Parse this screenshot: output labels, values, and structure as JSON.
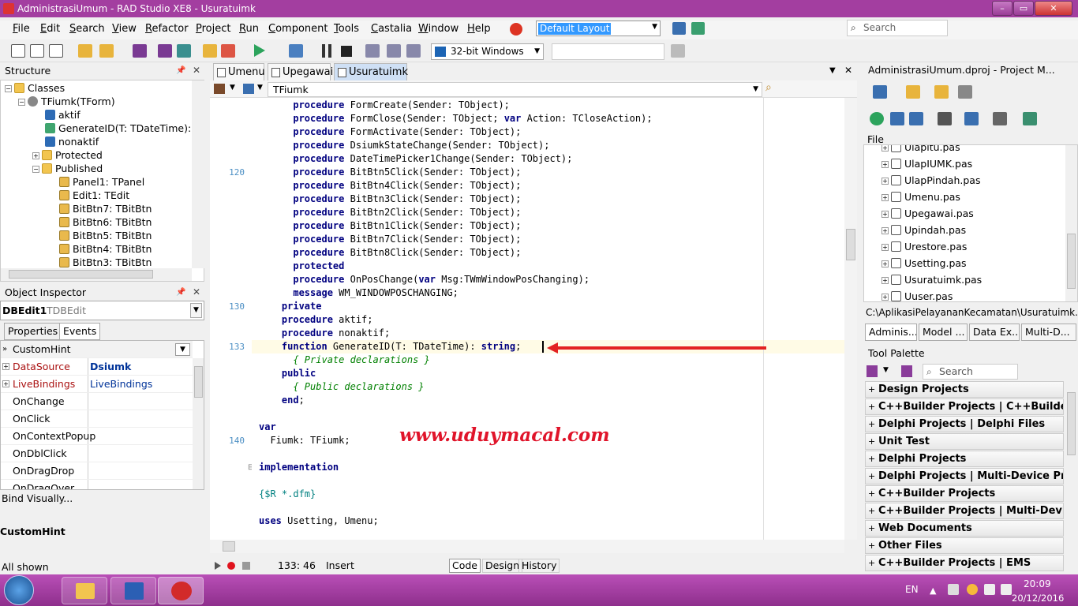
{
  "window": {
    "title": "AdministrasiUmum - RAD Studio XE8 - Usuratuimk"
  },
  "menu": [
    "File",
    "Edit",
    "Search",
    "View",
    "Refactor",
    "Project",
    "Run",
    "Component",
    "Tools",
    "Castalia",
    "Window",
    "Help"
  ],
  "layout_combo": "Default Layout",
  "search_top": "Search",
  "platform_combo": "32-bit Windows",
  "structure": {
    "title": "Structure",
    "rows": [
      "Classes",
      "TFiumk(TForm)",
      "aktif",
      "GenerateID(T: TDateTime): str",
      "nonaktif",
      "Protected",
      "Published",
      "Panel1: TPanel",
      "Edit1: TEdit",
      "BitBtn7: TBitBtn",
      "BitBtn6: TBitBtn",
      "BitBtn5: TBitBtn",
      "BitBtn4: TBitBtn",
      "BitBtn3: TBitBtn"
    ]
  },
  "object_inspector": {
    "title": "Object Inspector",
    "component": "DBEdit1",
    "component_type": "TDBEdit",
    "tab_properties": "Properties",
    "tab_events": "Events",
    "rows": [
      {
        "name": "CustomHint",
        "value": ""
      },
      {
        "name": "DataSource",
        "value": "Dsiumk"
      },
      {
        "name": "LiveBindings",
        "value": "LiveBindings"
      },
      {
        "name": "OnChange",
        "value": ""
      },
      {
        "name": "OnClick",
        "value": ""
      },
      {
        "name": "OnContextPopup",
        "value": ""
      },
      {
        "name": "OnDblClick",
        "value": ""
      },
      {
        "name": "OnDragDrop",
        "value": ""
      },
      {
        "name": "OnDragOver",
        "value": ""
      }
    ],
    "bind_visually": "Bind Visually...",
    "selected_prop": "CustomHint",
    "status": "All shown"
  },
  "editor": {
    "tabs": [
      "Umenu",
      "Upegawai",
      "Usuratuimk"
    ],
    "class_combo": "TFiumk",
    "line_numbers": [
      {
        "n": "120",
        "row": 5
      },
      {
        "n": "130",
        "row": 15
      },
      {
        "n": "133",
        "row": 18
      },
      {
        "n": "140",
        "row": 25
      }
    ],
    "lines": [
      "      procedure FormCreate(Sender: TObject);",
      "      procedure FormClose(Sender: TObject; var Action: TCloseAction);",
      "      procedure FormActivate(Sender: TObject);",
      "      procedure DsiumkStateChange(Sender: TObject);",
      "      procedure DateTimePicker1Change(Sender: TObject);",
      "      procedure BitBtn5Click(Sender: TObject);",
      "      procedure BitBtn4Click(Sender: TObject);",
      "      procedure BitBtn3Click(Sender: TObject);",
      "      procedure BitBtn2Click(Sender: TObject);",
      "      procedure BitBtn1Click(Sender: TObject);",
      "      procedure BitBtn7Click(Sender: TObject);",
      "      procedure BitBtn8Click(Sender: TObject);",
      "      protected",
      "      procedure OnPosChange(var Msg:TWmWindowPosChanging);",
      "      message WM_WINDOWPOSCHANGING;",
      "    private",
      "    procedure aktif;",
      "    procedure nonaktif;",
      "    function GenerateID(T: TDateTime): string;",
      "      { Private declarations }",
      "    public",
      "      { Public declarations }",
      "    end;",
      "",
      "var",
      "  Fiumk: TFiumk;",
      "",
      "implementation",
      "",
      "{$R *.dfm}",
      "",
      "uses Usetting, Umenu;"
    ],
    "watermark": "www.uduymacal.com",
    "cursor_pos": "133:  46",
    "mode": "Insert",
    "view_tabs": [
      "Code",
      "Design",
      "History"
    ]
  },
  "project_manager": {
    "title": "AdministrasiUmum.dproj - Project M...",
    "file_label": "File",
    "files": [
      "Ulapitu.pas",
      "UlapIUMK.pas",
      "UlapPindah.pas",
      "Umenu.pas",
      "Upegawai.pas",
      "Upindah.pas",
      "Urestore.pas",
      "Usetting.pas",
      "Usuratuimk.pas",
      "Uuser.pas"
    ],
    "path": "C:\\AplikasiPelayananKecamatan\\Usuratuimk.pas",
    "tabs": [
      "Adminis...",
      "Model ...",
      "Data Ex...",
      "Multi-D..."
    ]
  },
  "tool_palette": {
    "title": "Tool Palette",
    "search": "Search",
    "categories": [
      "Design Projects",
      "C++Builder Projects | C++Builder Files",
      "Delphi Projects | Delphi Files",
      "Unit Test",
      "Delphi Projects",
      "Delphi Projects | Multi-Device Proje...",
      "C++Builder Projects",
      "C++Builder Projects | Multi-Device ...",
      "Web Documents",
      "Other Files",
      "C++Builder Projects | EMS"
    ]
  },
  "taskbar": {
    "lang": "EN",
    "time": "20:09",
    "date": "20/12/2016"
  }
}
